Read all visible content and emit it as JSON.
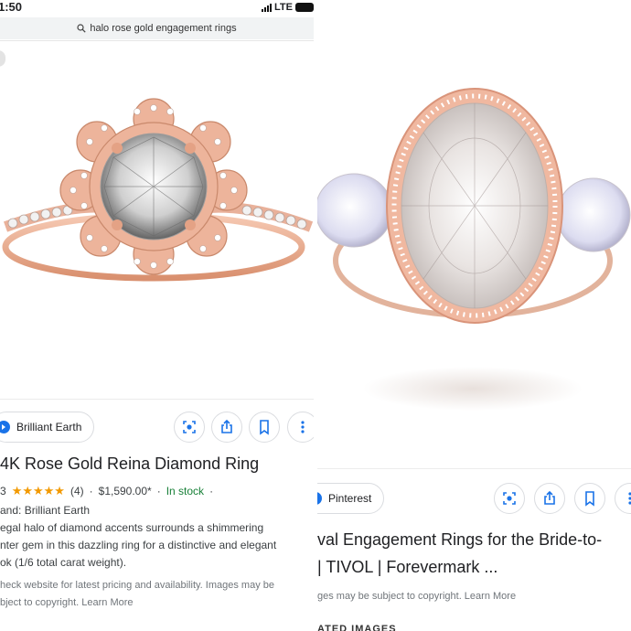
{
  "left": {
    "status": {
      "time": "1:50",
      "network": "LTE"
    },
    "search": {
      "query": "halo rose gold engagement rings"
    },
    "source": {
      "name": "Brilliant Earth"
    },
    "product": {
      "title": "4K Rose Gold Reina Diamond Ring",
      "rating_prefix": "3",
      "stars": "★★★★★",
      "review_count": "(4)",
      "price": "$1,590.00*",
      "availability": "In stock",
      "brand": "and: Brilliant Earth",
      "description": [
        "egal halo of diamond accents surrounds a shimmering",
        "nter gem in this dazzling ring for a distinctive and elegant",
        "ok (1/6 total carat weight)."
      ],
      "disclaimer": [
        "heck website for latest pricing and availability. Images may be",
        "bject to copyright. Learn More"
      ]
    }
  },
  "right": {
    "source": {
      "name": "Pinterest"
    },
    "title": [
      "val Engagement Rings for the Bride-to-",
      "| TIVOL | Forevermark ..."
    ],
    "disclaimer": "ges may be subject to copyright. Learn More",
    "related_heading": "ATED IMAGES"
  },
  "colors": {
    "rose_gold": "#e7a98c",
    "in_stock": "#188038",
    "star": "#f29900",
    "accent_blue": "#1a73e8"
  },
  "icons": [
    "search-icon",
    "lens-icon",
    "share-icon",
    "bookmark-icon",
    "more-icon",
    "source-logo-icon"
  ]
}
